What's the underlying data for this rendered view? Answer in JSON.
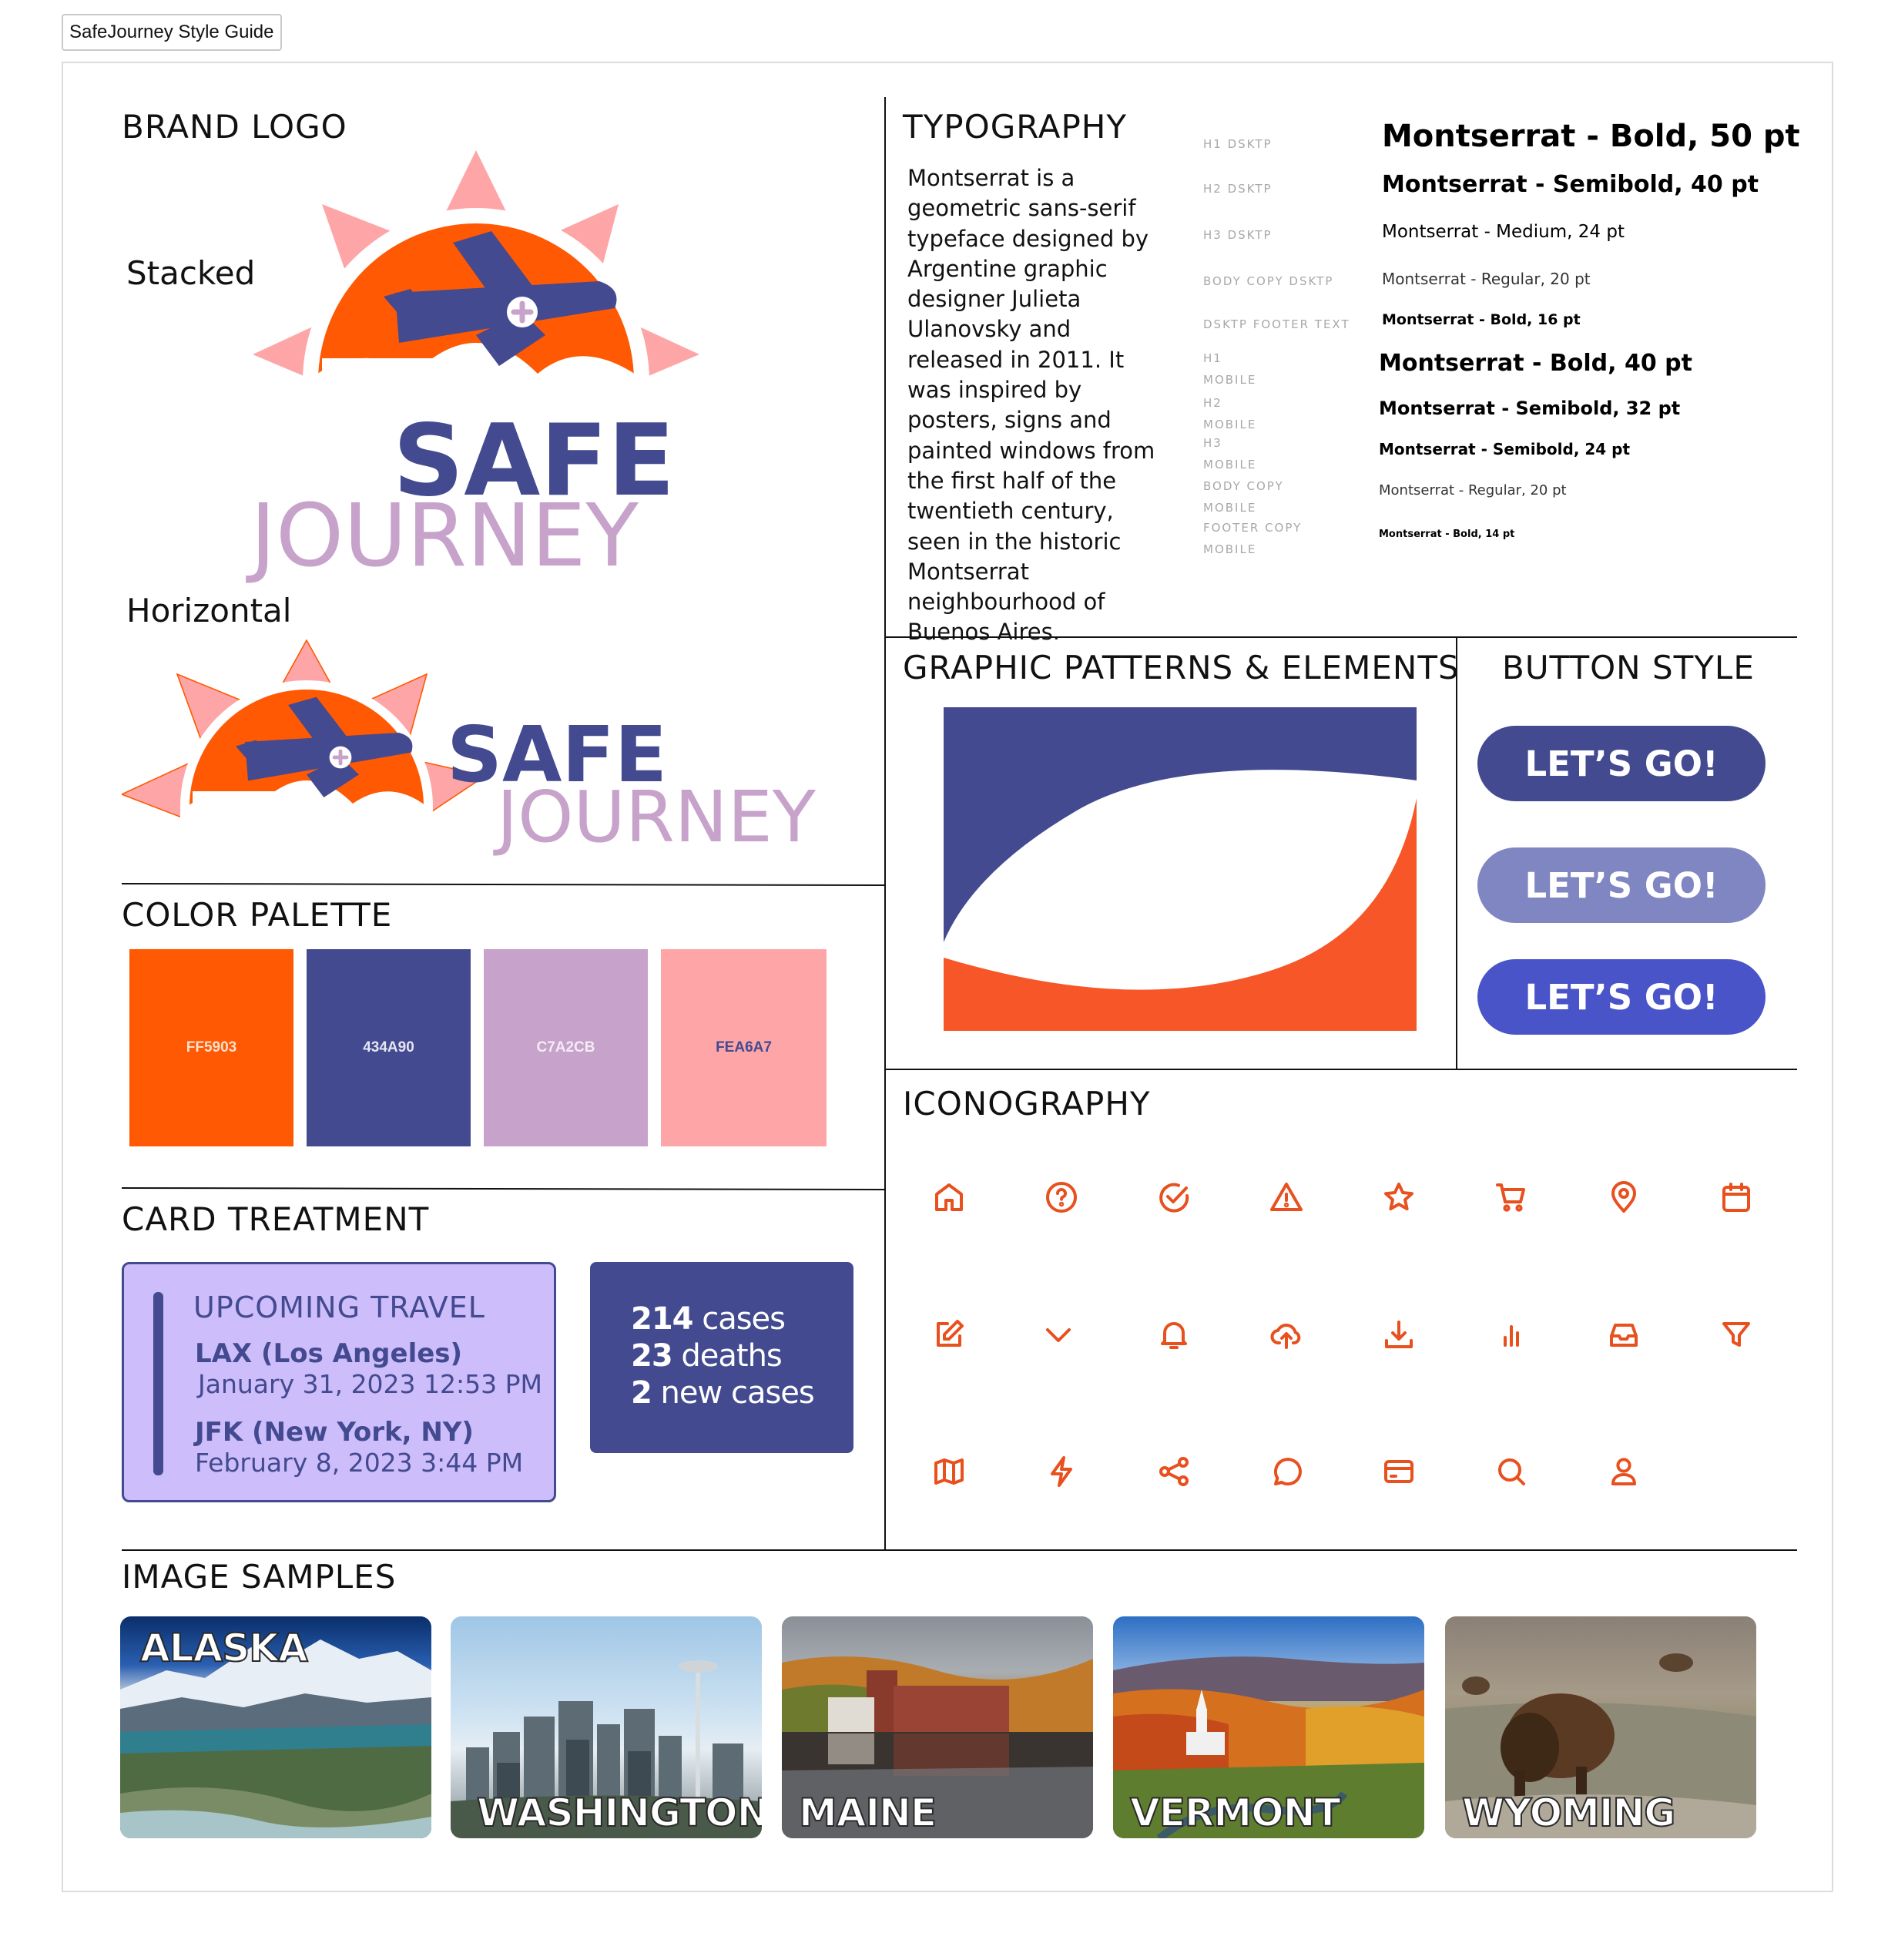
{
  "window": {
    "tab_title": "SafeJourney Style Guide"
  },
  "sections": {
    "brand_logo": "BRAND LOGO",
    "typography": "TYPOGRAPHY",
    "graphic_patterns": "GRAPHIC PATTERNS & ELEMENTS",
    "button_style": "BUTTON STYLE",
    "color_palette": "COLOR PALETTE",
    "iconography": "ICONOGRAPHY",
    "card_treatment": "CARD TREATMENT",
    "image_samples": "IMAGE SAMPLES"
  },
  "logo": {
    "stacked_label": "Stacked",
    "horizontal_label": "Horizontal",
    "word_safe": "SAFE",
    "word_journey": "JOURNEY"
  },
  "typography": {
    "description": "Montserrat is a geometric sans-serif typeface designed by Argentine graphic designer Julieta Ulanovsky and released in 2011. It was inspired by posters, signs and painted windows from the first half of the twentieth century, seen in the historic Montserrat neighbourhood of Buenos Aires.",
    "labels": [
      "H1 DSKTP",
      "H2 DSKTP",
      "H3 DSKTP",
      "BODY COPY DSKTP",
      "DSKTP FOOTER TEXT",
      "H1",
      "MOBILE",
      "H2",
      "MOBILE",
      "H3",
      "MOBILE",
      "BODY COPY",
      "MOBILE",
      "FOOTER COPY",
      "MOBILE"
    ],
    "samples": [
      "Montserrat - Bold, 50 pt",
      "Montserrat - Semibold, 40 pt",
      "Montserrat - Medium, 24 pt",
      "Montserrat - Regular, 20 pt",
      "Montserrat - Bold, 16 pt",
      "Montserrat - Bold, 40 pt",
      "Montserrat - Semibold, 32 pt",
      "Montserrat - Semibold, 24 pt",
      "Montserrat - Regular, 20 pt",
      "Montserrat - Bold, 14 pt"
    ]
  },
  "palette": [
    {
      "hex": "FF5903",
      "color": "#FF5903",
      "text_color": "#ffe0cc"
    },
    {
      "hex": "434A90",
      "color": "#434A90",
      "text_color": "#e6e6f2"
    },
    {
      "hex": "C7A2CB",
      "color": "#C7A2CB",
      "text_color": "#f4ecf5"
    },
    {
      "hex": "FEA6A7",
      "color": "#FEA6A7",
      "text_color": "#434A90"
    }
  ],
  "buttons": [
    {
      "label": "LET’S GO!",
      "color": "#434A90"
    },
    {
      "label": "LET’S GO!",
      "color": "#8086C2"
    },
    {
      "label": "LET’S GO!",
      "color": "#4A54C9"
    }
  ],
  "icons": [
    "home-icon",
    "help-circle-icon",
    "check-circle-icon",
    "alert-triangle-icon",
    "star-icon",
    "cart-icon",
    "map-pin-icon",
    "calendar-icon",
    "edit-icon",
    "chevron-down-icon",
    "bell-icon",
    "upload-cloud-icon",
    "download-icon",
    "bar-chart-icon",
    "inbox-icon",
    "filter-icon",
    "map-icon",
    "zap-icon",
    "share-icon",
    "message-circle-icon",
    "credit-card-icon",
    "search-icon",
    "user-icon"
  ],
  "card": {
    "title": "UPCOMING TRAVEL",
    "origin": "LAX (Los Angeles)",
    "origin_time": "January 31, 2023 12:53 PM",
    "destination": "JFK (New York, NY)",
    "destination_time": "February 8, 2023 3:44 PM"
  },
  "stats": {
    "cases_num": "214",
    "cases_label": " cases",
    "deaths_num": "23",
    "deaths_label": " deaths",
    "new_num": "2",
    "new_label": " new cases"
  },
  "images": [
    "ALASKA",
    "WASHINGTON",
    "MAINE",
    "VERMONT",
    "WYOMING"
  ],
  "colors": {
    "orange": "#FF5903",
    "navy": "#434A90",
    "lilac": "#C7A2CB",
    "pink": "#FEA6A7",
    "icon": "#e8501e",
    "card_bg": "#CDBDFB"
  }
}
